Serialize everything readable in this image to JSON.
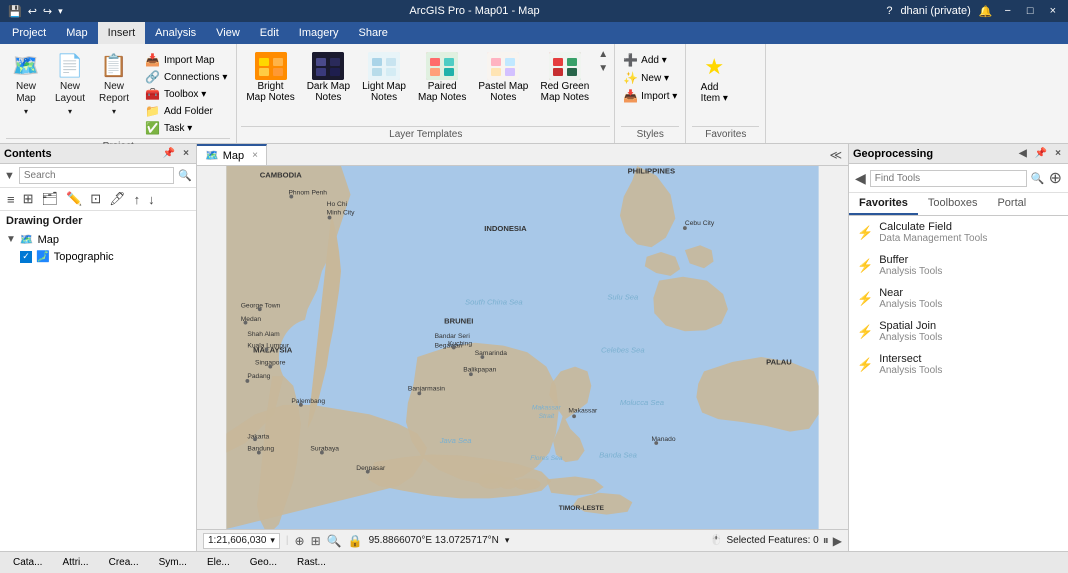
{
  "app": {
    "title": "ArcGIS Pro - Map01 - Map",
    "version": "ArcGIS Pro"
  },
  "titlebar": {
    "title": "ArcGIS Pro - Map01 - Map",
    "controls": [
      "?",
      "−",
      "□",
      "×"
    ],
    "question": "?",
    "minimize": "−",
    "maximize": "□",
    "close": "×",
    "quick_access": [
      "💾",
      "↩",
      "↪"
    ],
    "user": "dhani (private)",
    "notification_icon": "🔔"
  },
  "menubar": {
    "tabs": [
      "Project",
      "Map",
      "Insert",
      "Analysis",
      "View",
      "Edit",
      "Imagery",
      "Share"
    ],
    "active_tab": "Insert"
  },
  "ribbon": {
    "groups": [
      {
        "name": "Project",
        "items": [
          {
            "label": "New\nMap",
            "icon": "🗺️"
          },
          {
            "label": "New\nLayout",
            "icon": "📄"
          },
          {
            "label": "New\nReport",
            "icon": "📋"
          }
        ],
        "small_items": [
          {
            "label": "Import Map",
            "icon": "📥"
          },
          {
            "label": "Connections",
            "icon": "🔗"
          },
          {
            "label": "Toolbox",
            "icon": "🧰"
          },
          {
            "label": "Add Folder",
            "icon": "📁"
          },
          {
            "label": "Task",
            "icon": "✅"
          }
        ]
      }
    ],
    "layer_templates": {
      "label": "Layer Templates",
      "items": [
        {
          "id": "bright",
          "label": "Bright\nMap Notes",
          "colors": [
            "#ff8c00",
            "#ffd700"
          ]
        },
        {
          "id": "dark",
          "label": "Dark Map\nNotes",
          "colors": [
            "#1a1a2e",
            "#16213e"
          ]
        },
        {
          "id": "light",
          "label": "Light Map\nNotes",
          "colors": [
            "#e8f4f8",
            "#b8d4e8"
          ]
        },
        {
          "id": "paired",
          "label": "Paired\nMap Notes",
          "colors": [
            "#ff6b6b",
            "#4ecdc4"
          ]
        },
        {
          "id": "pastel",
          "label": "Pastel Map\nNotes",
          "colors": [
            "#ffb3c1",
            "#c1e8ff"
          ]
        },
        {
          "id": "redgreen",
          "label": "Red Green\nMap Notes",
          "colors": [
            "#e53e3e",
            "#38a169"
          ]
        }
      ]
    },
    "styles": {
      "label": "Styles",
      "items": [
        {
          "label": "Add",
          "icon": "➕"
        },
        {
          "label": "New",
          "icon": "✨"
        },
        {
          "label": "Import",
          "icon": "📥"
        }
      ]
    },
    "favorites": {
      "label": "Favorites",
      "add_item": "Add\nItem"
    }
  },
  "contents": {
    "title": "Contents",
    "search_placeholder": "Search",
    "drawing_order": "Drawing Order",
    "tree": [
      {
        "label": "Map",
        "type": "map",
        "expanded": true,
        "level": 0
      },
      {
        "label": "Topographic",
        "type": "layer",
        "checked": true,
        "level": 1
      }
    ],
    "tools": [
      "🔍",
      "📋",
      "🗂️",
      "✏️",
      "⊞",
      "🖊️",
      "⬆️",
      "⬇️"
    ]
  },
  "map": {
    "tab_label": "Map",
    "scale": "1:21,606,030",
    "coordinates": "95.8866070°E  13.0725717°N",
    "selected_features": "Selected Features: 0",
    "status_icons": [
      "⏸",
      "▶"
    ]
  },
  "geoprocessing": {
    "title": "Geoprocessing",
    "search_placeholder": "Find Tools",
    "tabs": [
      "Favorites",
      "Toolboxes",
      "Portal"
    ],
    "active_tab": "Favorites",
    "items": [
      {
        "label": "Calculate Field",
        "sub": "Data Management Tools",
        "icon": "⚡"
      },
      {
        "label": "Buffer",
        "sub": "Analysis Tools",
        "icon": "⚡"
      },
      {
        "label": "Near",
        "sub": "Analysis Tools",
        "icon": "⚡"
      },
      {
        "label": "Spatial Join",
        "sub": "Analysis Tools",
        "icon": "⚡"
      },
      {
        "label": "Intersect",
        "sub": "Analysis Tools",
        "icon": "⚡"
      }
    ]
  },
  "bottom_tabs": [
    "Cata...",
    "Attri...",
    "Crea...",
    "Sym...",
    "Ele...",
    "Geo...",
    "Rast..."
  ],
  "map_data": {
    "ocean_color": "#a8c8e8",
    "land_color": "#c8b89a",
    "places": [
      {
        "name": "CAMBODIA",
        "x": 35,
        "y": 15
      },
      {
        "name": "Phnom Penh",
        "x": 38,
        "y": 22
      },
      {
        "name": "Ho Chi Minh City",
        "x": 46,
        "y": 23
      },
      {
        "name": "PHILIPPINES",
        "x": 72,
        "y": 12
      },
      {
        "name": "MALAYSIA",
        "x": 28,
        "y": 38
      },
      {
        "name": "Shah Alam",
        "x": 26,
        "y": 45
      },
      {
        "name": "Kuala Lumpur",
        "x": 27,
        "y": 48
      },
      {
        "name": "Singapore",
        "x": 29,
        "y": 54
      },
      {
        "name": "BRUNEI",
        "x": 54,
        "y": 37
      },
      {
        "name": "INDONESIA",
        "x": 55,
        "y": 70
      },
      {
        "name": "Jakarta",
        "x": 28,
        "y": 68
      },
      {
        "name": "Bandung",
        "x": 30,
        "y": 72
      },
      {
        "name": "Surabaya",
        "x": 40,
        "y": 72
      },
      {
        "name": "Makassar",
        "x": 62,
        "y": 65
      },
      {
        "name": "Samarinda",
        "x": 57,
        "y": 47
      },
      {
        "name": "Balikpapan",
        "x": 55,
        "y": 52
      },
      {
        "name": "Banjarmasin",
        "x": 50,
        "y": 58
      },
      {
        "name": "Manado",
        "x": 72,
        "y": 53
      },
      {
        "name": "Padang",
        "x": 16,
        "y": 52
      },
      {
        "name": "Palembang",
        "x": 24,
        "y": 58
      },
      {
        "name": "Denpasar",
        "x": 42,
        "y": 76
      },
      {
        "name": "PALAU",
        "x": 87,
        "y": 30
      },
      {
        "name": "TIMOR-LESTE",
        "x": 55,
        "y": 82
      },
      {
        "name": "George Town",
        "x": 20,
        "y": 35
      },
      {
        "name": "Kuching",
        "x": 41,
        "y": 45
      },
      {
        "name": "Medan",
        "x": 17,
        "y": 40
      },
      {
        "name": "Cebu City",
        "x": 75,
        "y": 22
      }
    ]
  }
}
